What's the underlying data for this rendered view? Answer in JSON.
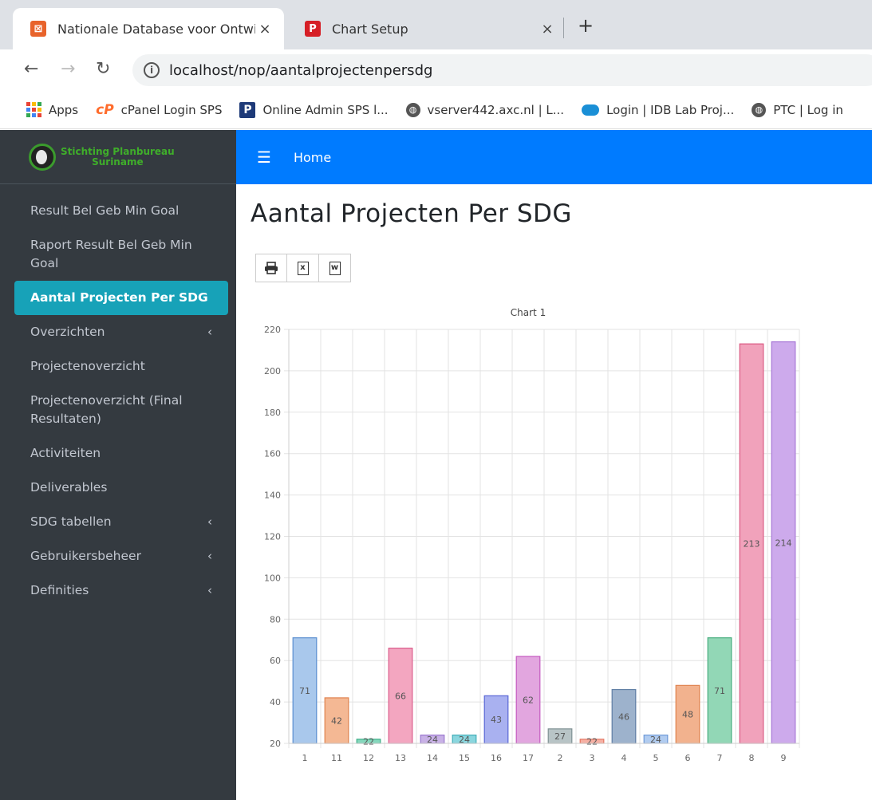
{
  "browser": {
    "tabs": [
      {
        "title": "Nationale Database voor Ontwik",
        "icon": "orange-app-icon",
        "active": true
      },
      {
        "title": "Chart Setup",
        "icon": "red-p-icon",
        "active": false
      }
    ],
    "url": "localhost/nop/aantalprojectenpersdg",
    "bookmarks": [
      {
        "label": "Apps",
        "icon": "apps-grid-icon"
      },
      {
        "label": "cPanel Login SPS",
        "icon": "cpanel-icon"
      },
      {
        "label": "Online Admin SPS l...",
        "icon": "p-box-icon"
      },
      {
        "label": "vserver442.axc.nl | L...",
        "icon": "globe-icon"
      },
      {
        "label": "Login | IDB Lab Proj...",
        "icon": "cloud-icon"
      },
      {
        "label": "PTC | Log in",
        "icon": "globe-icon"
      }
    ]
  },
  "brand": {
    "line1": "Stichting Planbureau",
    "line2": "Suriname"
  },
  "topnav": {
    "home": "Home"
  },
  "sidebar": {
    "items": [
      {
        "label": "Result Bel Geb Min Goal"
      },
      {
        "label": "Raport Result Bel Geb Min Goal"
      },
      {
        "label": "Aantal Projecten Per SDG",
        "active": true
      },
      {
        "label": "Overzichten",
        "chevron": true
      },
      {
        "label": "Projectenoverzicht"
      },
      {
        "label": "Projectenoverzicht (Final Resultaten)"
      },
      {
        "label": "Activiteiten"
      },
      {
        "label": "Deliverables"
      },
      {
        "label": "SDG tabellen",
        "chevron": true
      },
      {
        "label": "Gebruikersbeheer",
        "chevron": true
      },
      {
        "label": "Definities",
        "chevron": true
      }
    ]
  },
  "page": {
    "title": "Aantal Projecten Per SDG"
  },
  "toolbar": [
    "print-icon",
    "excel-icon",
    "word-icon"
  ],
  "chart_data": {
    "type": "bar",
    "title": "Chart 1",
    "categories": [
      "1",
      "11",
      "12",
      "13",
      "14",
      "15",
      "16",
      "17",
      "2",
      "3",
      "4",
      "5",
      "6",
      "7",
      "8",
      "9"
    ],
    "values": [
      71,
      42,
      22,
      66,
      24,
      24,
      43,
      62,
      27,
      22,
      46,
      24,
      48,
      71,
      213,
      214
    ],
    "colors": [
      "#a9c8ec",
      "#f4b894",
      "#86d8bd",
      "#f3a6c0",
      "#c8b1e6",
      "#8ad6de",
      "#a9b1f0",
      "#e2a6df",
      "#b8c4c6",
      "#f6b0a4",
      "#9db2cc",
      "#b1ccf0",
      "#f2b28e",
      "#92d7b6",
      "#f1a2bb",
      "#cdaaec"
    ],
    "borders": [
      "#5a8fd0",
      "#e0834f",
      "#3fae87",
      "#db5c8b",
      "#9a78cf",
      "#43aeb8",
      "#5966d6",
      "#c45ac0",
      "#7f9193",
      "#e57762",
      "#5f7ea4",
      "#6f9ad8",
      "#e08450",
      "#49ae80",
      "#db5a82",
      "#a777d6"
    ],
    "ylim": [
      20,
      220
    ],
    "yticks": [
      20,
      40,
      60,
      80,
      100,
      120,
      140,
      160,
      180,
      200,
      220
    ],
    "grid": true,
    "data_labels": true
  }
}
